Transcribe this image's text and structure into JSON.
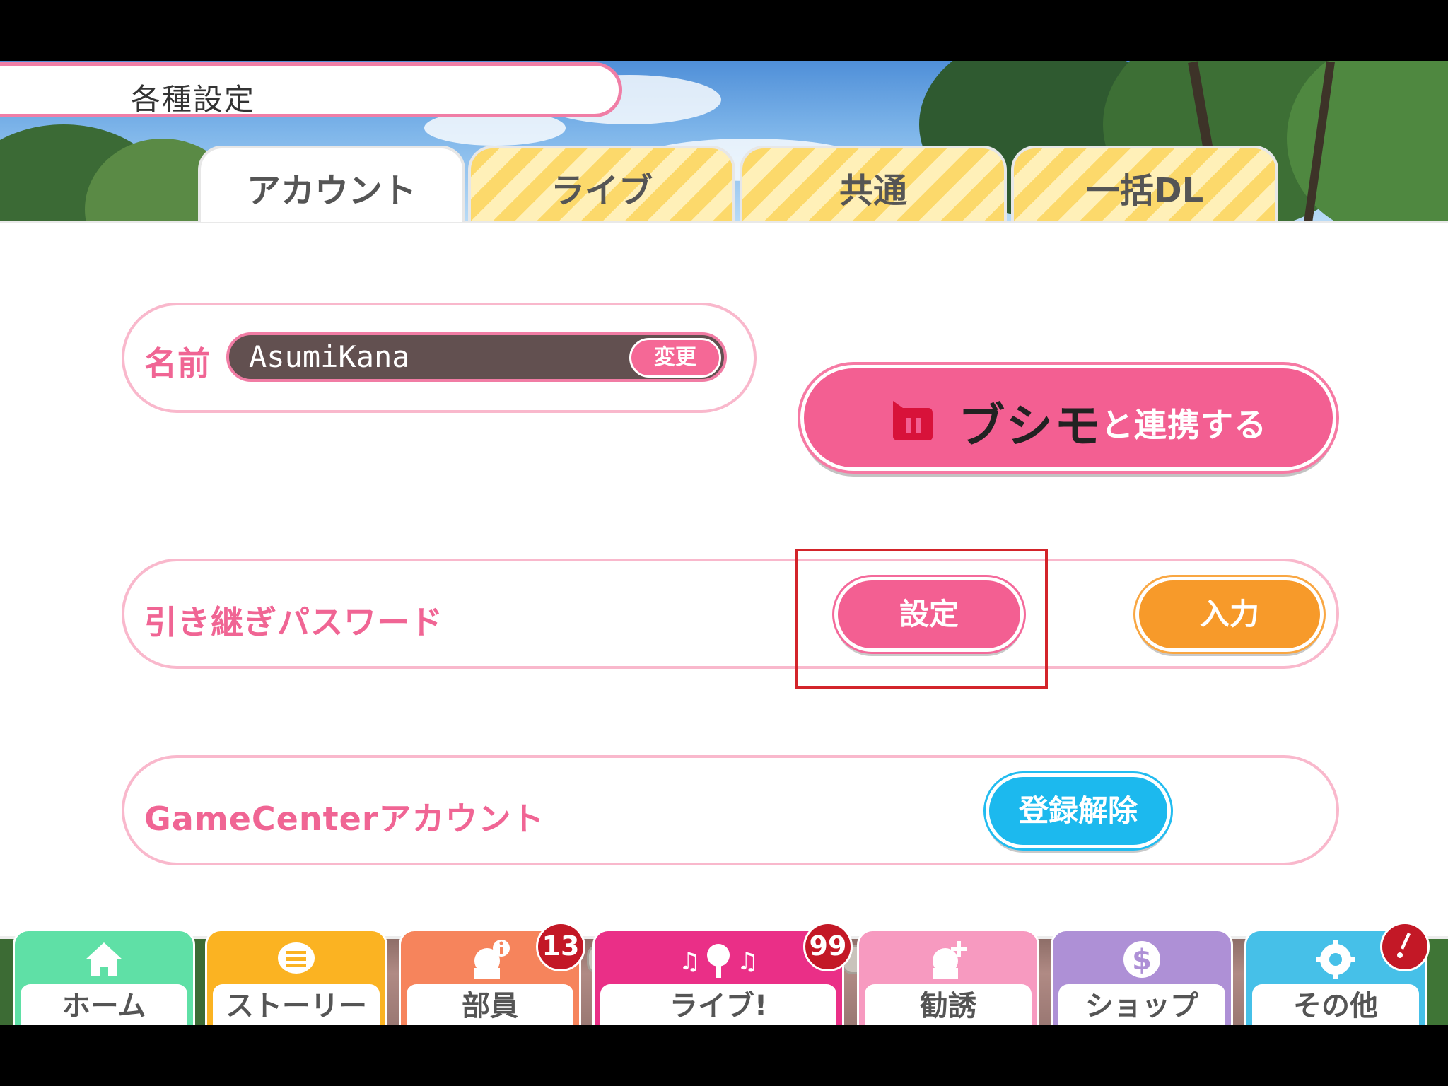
{
  "header": {
    "title": "各種設定"
  },
  "tabs": [
    {
      "label": "アカウント",
      "active": true
    },
    {
      "label": "ライブ",
      "active": false
    },
    {
      "label": "共通",
      "active": false
    },
    {
      "label": "一括DL",
      "active": false
    }
  ],
  "account": {
    "name_label": "名前",
    "name_value": "AsumiKana",
    "change_label": "変更",
    "bushimo_name": "ブシモ",
    "bushimo_suffix": "と連携する",
    "password_label": "引き継ぎパスワード",
    "set_label": "設定",
    "input_label": "入力",
    "gamecenter_label": "GameCenterアカウント",
    "unregister_label": "登録解除"
  },
  "colors": {
    "accent_pink": "#f35f92",
    "orange": "#f79a2a",
    "blue": "#1cb9ee",
    "highlight_red": "#d3242a"
  },
  "nav": {
    "items": [
      {
        "label": "ホーム",
        "icon": "home-icon",
        "color": "#5fe0a6"
      },
      {
        "label": "ストーリー",
        "icon": "speech-bubble-icon",
        "color": "#fbb322"
      },
      {
        "label": "部員",
        "icon": "member-info-icon",
        "color": "#f6845c",
        "badge": "13"
      },
      {
        "label": "ライブ!",
        "icon": "microphone-notes-icon",
        "color": "#ea2f87",
        "badge": "99"
      },
      {
        "label": "勧誘",
        "icon": "member-add-icon",
        "color": "#f79ac0"
      },
      {
        "label": "ショップ",
        "icon": "dollar-icon",
        "color": "#ae90d6"
      },
      {
        "label": "その他",
        "icon": "gear-icon",
        "color": "#46c0e8",
        "badge_icon": "alert-icon"
      }
    ]
  }
}
